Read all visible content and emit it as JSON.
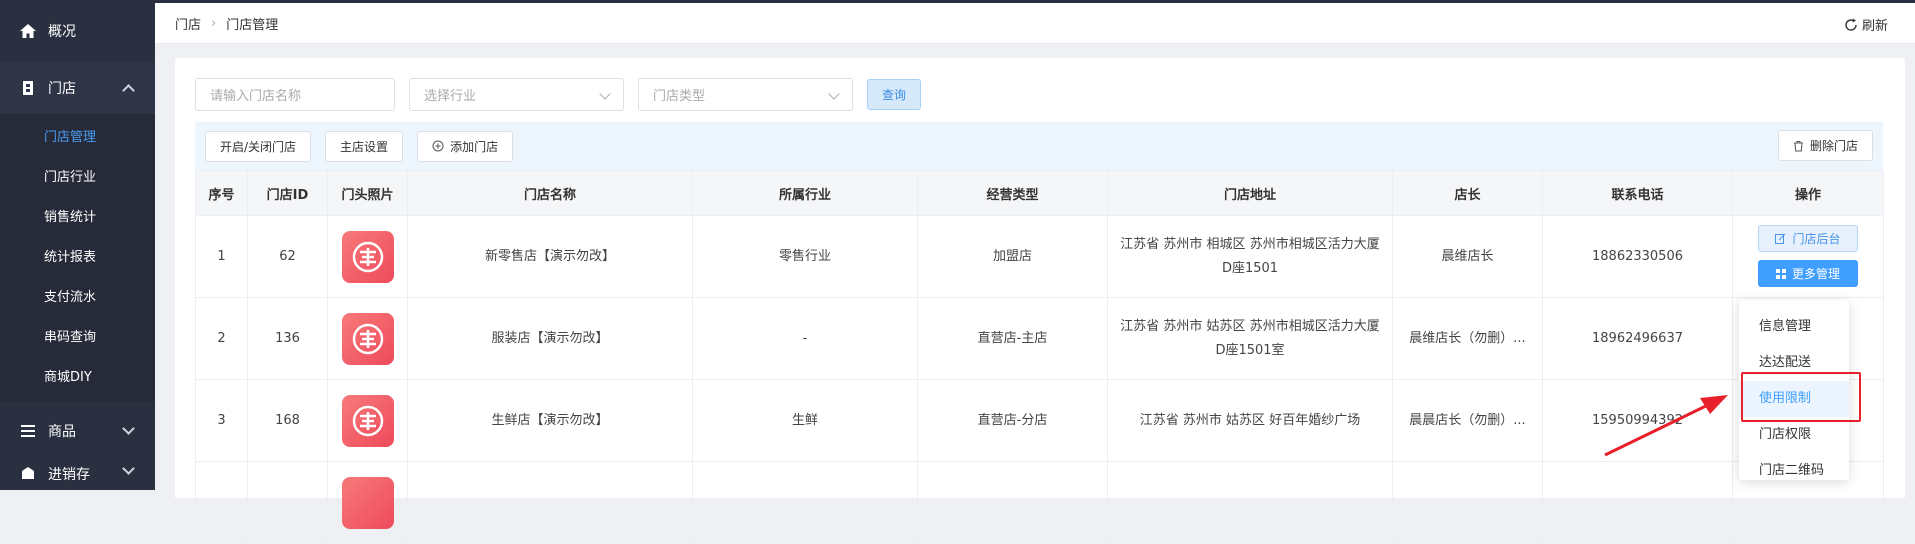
{
  "sidebar": {
    "items": [
      {
        "label": "概况",
        "icon": "home-icon"
      },
      {
        "label": "门店",
        "icon": "store-icon",
        "expanded": true,
        "children": [
          "门店管理",
          "门店行业",
          "销售统计",
          "统计报表",
          "支付流水",
          "串码查询",
          "商城DIY"
        ]
      },
      {
        "label": "商品",
        "icon": "menu-icon"
      },
      {
        "label": "进销存",
        "icon": "warehouse-icon"
      }
    ],
    "active_child": "门店管理"
  },
  "breadcrumb": [
    "门店",
    "门店管理"
  ],
  "refresh_label": "刷新",
  "filters": {
    "name_placeholder": "请输入门店名称",
    "industry_placeholder": "选择行业",
    "type_placeholder": "门店类型",
    "query_label": "查询"
  },
  "toolbar": {
    "toggle_label": "开启/关闭门店",
    "main_store_label": "主店设置",
    "add_label": "添加门店",
    "delete_label": "删除门店"
  },
  "table": {
    "columns": [
      "序号",
      "门店ID",
      "门头照片",
      "门店名称",
      "所属行业",
      "经营类型",
      "门店地址",
      "店长",
      "联系电话",
      "操作"
    ],
    "rows": [
      {
        "idx": "1",
        "id": "62",
        "name": "新零售店【演示勿改】",
        "industry": "零售行业",
        "type": "加盟店",
        "address": "江苏省 苏州市 相城区 苏州市相城区活力大厦D座1501",
        "manager": "晨维店长",
        "phone": "18862330506"
      },
      {
        "idx": "2",
        "id": "136",
        "name": "服装店【演示勿改】",
        "industry": "-",
        "type": "直营店-主店",
        "address": "江苏省 苏州市 姑苏区 苏州市相城区活力大厦D座1501室",
        "manager": "晨维店长（勿删）...",
        "phone": "18962496637"
      },
      {
        "idx": "3",
        "id": "168",
        "name": "生鲜店【演示勿改】",
        "industry": "生鲜",
        "type": "直营店-分店",
        "address": "江苏省 苏州市 姑苏区 好百年婚纱广场",
        "manager": "晨晨店长（勿删）...",
        "phone": "15950994392"
      }
    ],
    "op_backend_label": "门店后台",
    "op_more_label": "更多管理"
  },
  "dropdown_menu": [
    "信息管理",
    "达达配送",
    "使用限制",
    "门店权限",
    "门店二维码"
  ],
  "highlighted_menu_item": "使用限制",
  "colors": {
    "sidebar_bg": "#2b3041",
    "accent": "#409eff",
    "annotation": "#e8202a"
  }
}
